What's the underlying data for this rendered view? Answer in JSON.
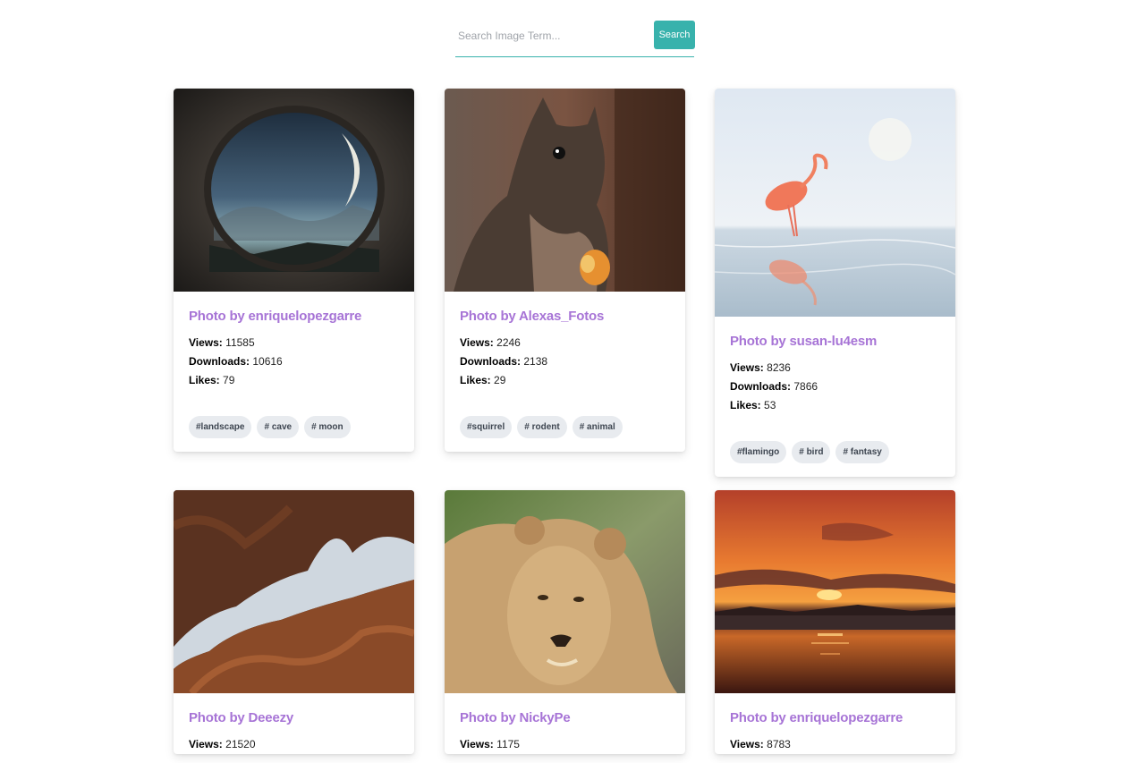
{
  "search": {
    "placeholder": "Search Image Term...",
    "button_label": "Search"
  },
  "labels": {
    "views": "Views:",
    "downloads": "Downloads:",
    "likes": "Likes:"
  },
  "cards": [
    {
      "title": "Photo by enriquelopezgarre",
      "views": "11585",
      "downloads": "10616",
      "likes": "79",
      "tags": [
        "#landscape",
        "# cave",
        "# moon"
      ]
    },
    {
      "title": "Photo by Alexas_Fotos",
      "views": "2246",
      "downloads": "2138",
      "likes": "29",
      "tags": [
        "#squirrel",
        "# rodent",
        "# animal"
      ]
    },
    {
      "title": "Photo by susan-lu4esm",
      "views": "8236",
      "downloads": "7866",
      "likes": "53",
      "tags": [
        "#flamingo",
        "# bird",
        "# fantasy"
      ]
    },
    {
      "title": "Photo by Deeezy",
      "views": "21520"
    },
    {
      "title": "Photo by NickyPe",
      "views": "1175"
    },
    {
      "title": "Photo by enriquelopezgarre",
      "views": "8783"
    }
  ]
}
